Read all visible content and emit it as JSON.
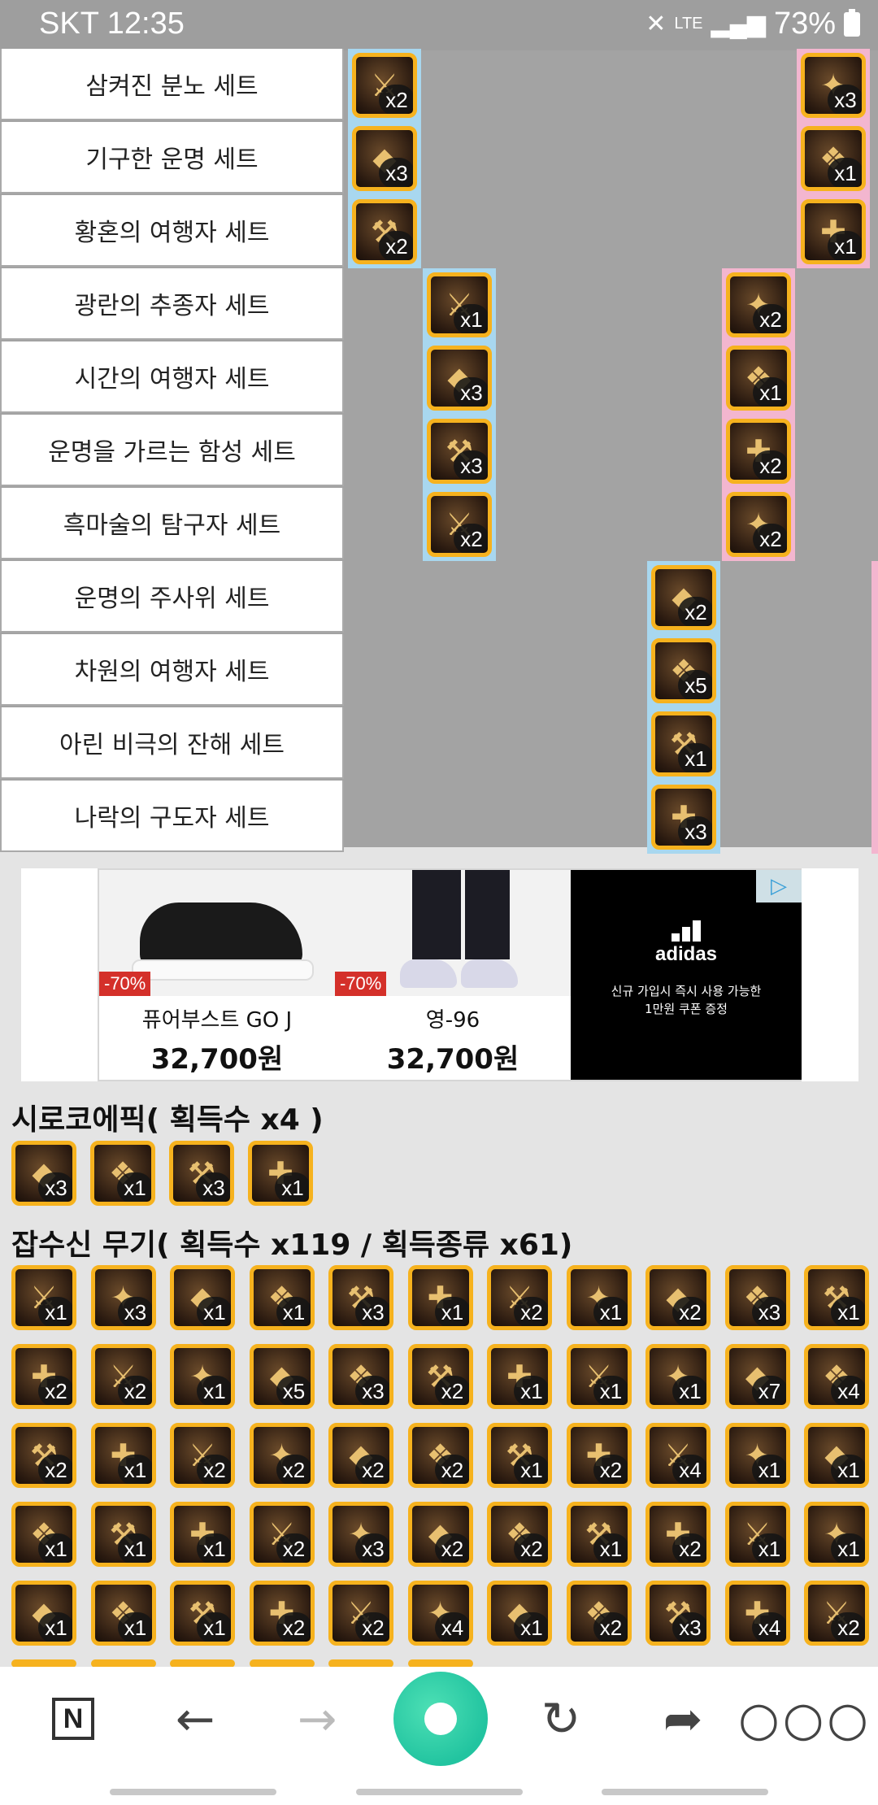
{
  "status_bar": {
    "carrier_time": "SKT 12:35",
    "network": "LTE",
    "battery": "73%"
  },
  "set_rows": [
    {
      "name": "삼켜진 분노 세트"
    },
    {
      "name": "기구한 운명 세트"
    },
    {
      "name": "황혼의 여행자 세트"
    },
    {
      "name": "광란의 추종자 세트"
    },
    {
      "name": "시간의 여행자 세트"
    },
    {
      "name": "운명을 가르는 함성 세트"
    },
    {
      "name": "흑마술의 탐구자 세트"
    },
    {
      "name": "운명의 주사위 세트"
    },
    {
      "name": "차원의 여행자 세트"
    },
    {
      "name": "아린 비극의 잔해 세트"
    },
    {
      "name": "나락의 구도자 세트"
    }
  ],
  "set_items": [
    {
      "row": 0,
      "col": 0,
      "count": "x2",
      "tint": "blue"
    },
    {
      "row": 0,
      "col": 6,
      "count": "x3",
      "tint": "pink"
    },
    {
      "row": 1,
      "col": 0,
      "count": "x3",
      "tint": "blue"
    },
    {
      "row": 1,
      "col": 6,
      "count": "x1",
      "tint": "pink"
    },
    {
      "row": 2,
      "col": 0,
      "count": "x2",
      "tint": "blue"
    },
    {
      "row": 2,
      "col": 6,
      "count": "x1",
      "tint": "pink"
    },
    {
      "row": 3,
      "col": 1,
      "count": "x1",
      "tint": "blue"
    },
    {
      "row": 3,
      "col": 5,
      "count": "x2",
      "tint": "pink"
    },
    {
      "row": 4,
      "col": 1,
      "count": "x3",
      "tint": "blue"
    },
    {
      "row": 4,
      "col": 5,
      "count": "x1",
      "tint": "pink"
    },
    {
      "row": 5,
      "col": 1,
      "count": "x3",
      "tint": "blue"
    },
    {
      "row": 5,
      "col": 5,
      "count": "x2",
      "tint": "pink"
    },
    {
      "row": 6,
      "col": 1,
      "count": "x2",
      "tint": "blue"
    },
    {
      "row": 6,
      "col": 5,
      "count": "x2",
      "tint": "pink"
    },
    {
      "row": 7,
      "col": 4,
      "count": "x2",
      "tint": "blue"
    },
    {
      "row": 8,
      "col": 4,
      "count": "x5",
      "tint": "blue"
    },
    {
      "row": 9,
      "col": 4,
      "count": "x1",
      "tint": "blue"
    },
    {
      "row": 10,
      "col": 4,
      "count": "x3",
      "tint": "blue"
    }
  ],
  "ad": {
    "products": [
      {
        "name": "퓨어부스트 GO J",
        "discount": "-70%",
        "price": "32,700원"
      },
      {
        "name": "영-96",
        "discount": "-70%",
        "price": "32,700원"
      }
    ],
    "banner_logo": "adidas",
    "banner_line1": "신규 가입시 즉시 사용 가능한",
    "banner_line2": "1만원 쿠폰 증정"
  },
  "epic_section": {
    "title": "시로코에픽( 획득수 x4 )",
    "items": [
      "x3",
      "x1",
      "x3",
      "x1"
    ]
  },
  "weapon_section": {
    "title": "잡수신 무기( 획득수 x119 / 획득종류 x61)",
    "rows": [
      [
        "x1",
        "x3",
        "x1",
        "x1",
        "x3",
        "x1",
        "x2",
        "x1",
        "x2",
        "x3",
        "x1"
      ],
      [
        "x2",
        "x2",
        "x1",
        "x5",
        "x3",
        "x2",
        "x1",
        "x1",
        "x1",
        "x7",
        "x4"
      ],
      [
        "x2",
        "x1",
        "x2",
        "x2",
        "x2",
        "x2",
        "x1",
        "x2",
        "x4",
        "x1",
        "x1"
      ],
      [
        "x1",
        "x1",
        "x1",
        "x2",
        "x3",
        "x2",
        "x2",
        "x1",
        "x2",
        "x1",
        "x1"
      ],
      [
        "x1",
        "x1",
        "x1",
        "x2",
        "x2",
        "x4",
        "x1",
        "x2",
        "x3",
        "x4",
        "x2"
      ]
    ]
  },
  "nav": {
    "home_label": "N"
  },
  "colors": {
    "item_border": "#f6b21e",
    "blue_tint": "#a8d7ef",
    "pink_tint": "#f3b6cf",
    "nav_green": "#22c4a0"
  }
}
